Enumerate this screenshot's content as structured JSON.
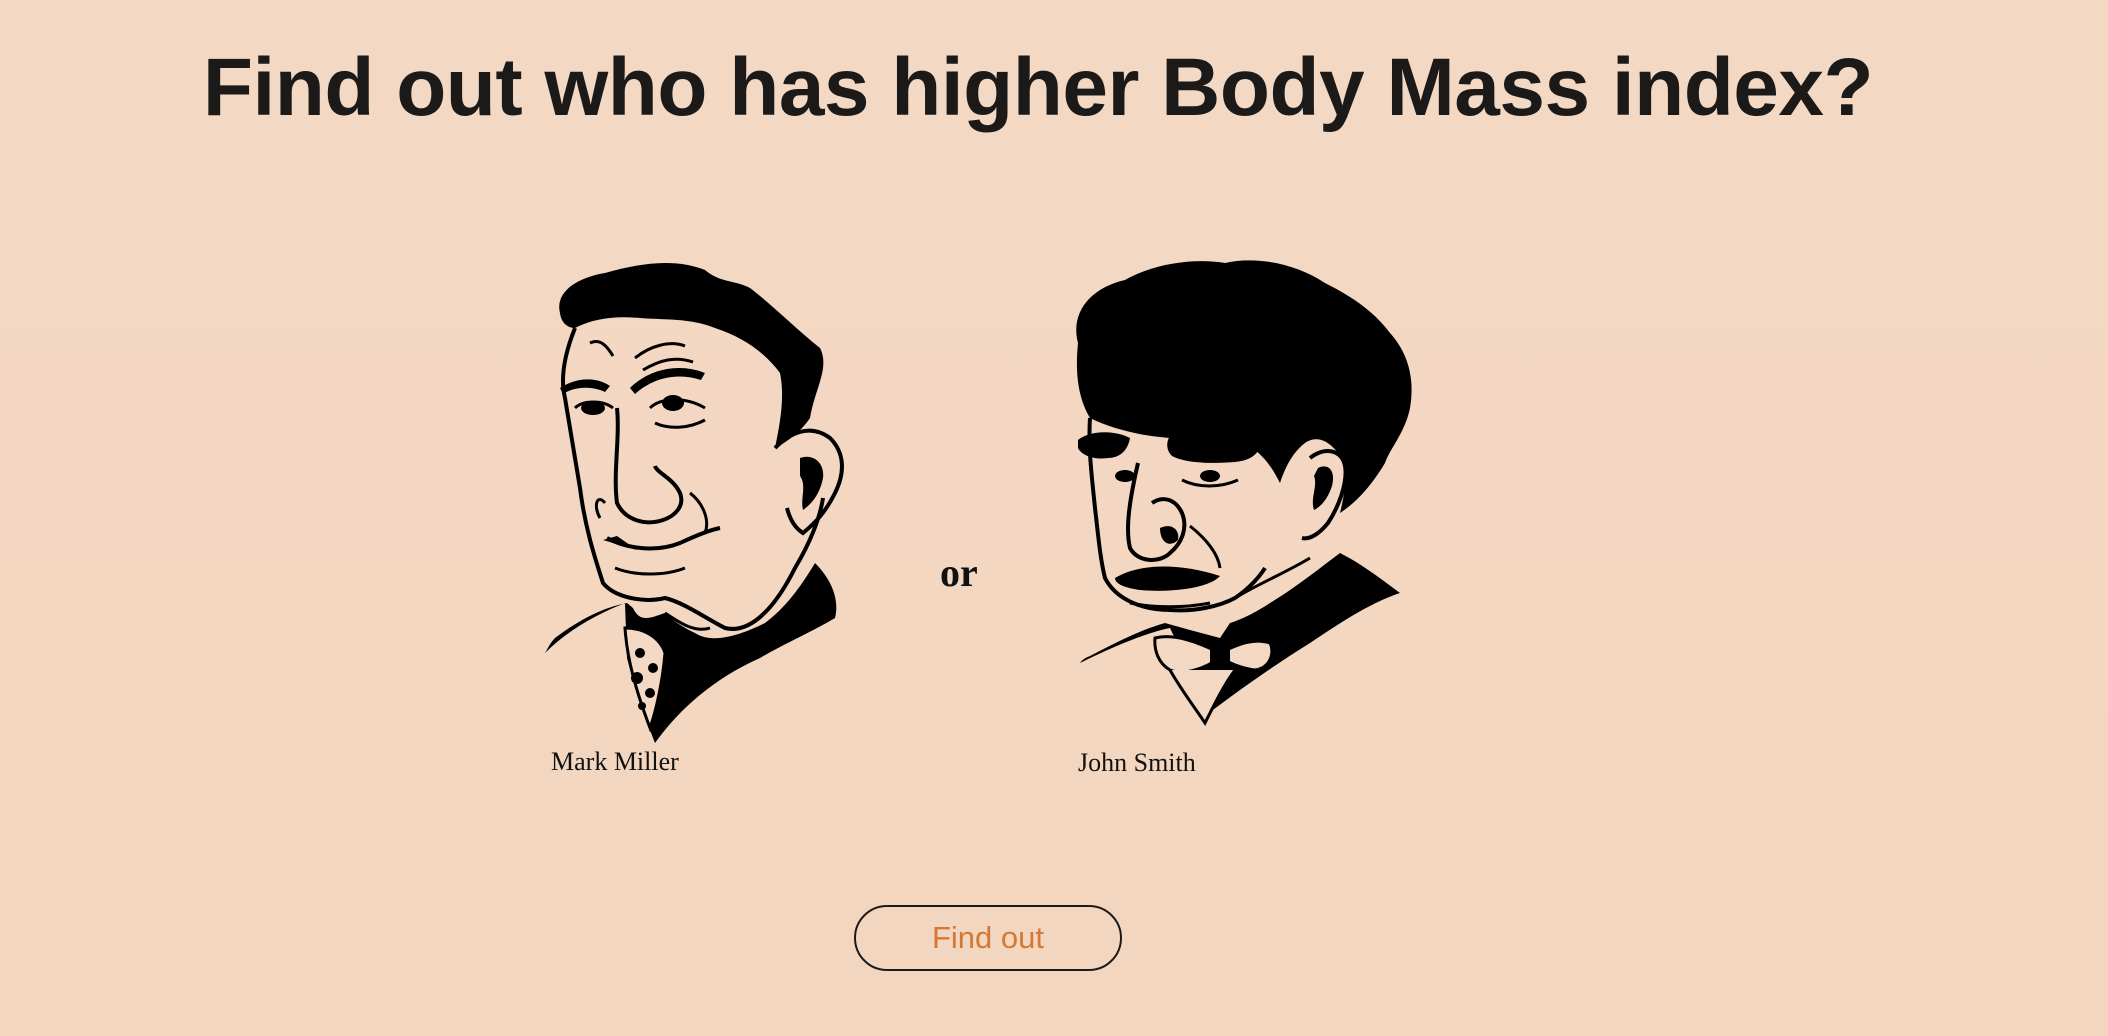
{
  "page": {
    "title": "Find out who has higher Body Mass index?",
    "separator": "or"
  },
  "people": [
    {
      "name": "Mark Miller",
      "portrait_icon": "caricature-portrait-icon"
    },
    {
      "name": "John Smith",
      "portrait_icon": "caricature-portrait-icon"
    }
  ],
  "actions": {
    "find_out_label": "Find out"
  },
  "colors": {
    "background": "#f3d8c4",
    "title_text": "#1c1a19",
    "button_text": "#d27a35",
    "button_border": "#1d1b1a"
  }
}
